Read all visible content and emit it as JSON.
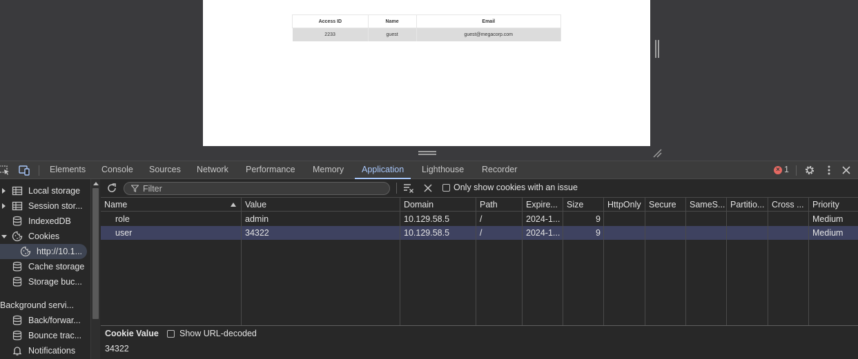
{
  "webpage": {
    "table": {
      "headers": [
        "Access ID",
        "Name",
        "Email"
      ],
      "rows": [
        [
          "2233",
          "guest",
          "guest@megacorp.com"
        ]
      ]
    }
  },
  "devtools": {
    "tabs": [
      {
        "label": "Elements",
        "active": false
      },
      {
        "label": "Console",
        "active": false
      },
      {
        "label": "Sources",
        "active": false
      },
      {
        "label": "Network",
        "active": false
      },
      {
        "label": "Performance",
        "active": false
      },
      {
        "label": "Memory",
        "active": false
      },
      {
        "label": "Application",
        "active": true
      },
      {
        "label": "Lighthouse",
        "active": false
      },
      {
        "label": "Recorder",
        "active": false
      }
    ],
    "error_count": "1",
    "sidebar": {
      "items": [
        {
          "label": "Local storage",
          "icon": "table-icon",
          "expandable": true
        },
        {
          "label": "Session stor...",
          "icon": "table-icon",
          "expandable": true
        },
        {
          "label": "IndexedDB",
          "icon": "database-icon"
        },
        {
          "label": "Cookies",
          "icon": "cookie-icon",
          "expanded": true
        },
        {
          "label": "http://10.1...",
          "icon": "cookie-icon",
          "selected": true
        },
        {
          "label": "Cache storage",
          "icon": "database-icon"
        },
        {
          "label": "Storage buc...",
          "icon": "database-icon"
        },
        {
          "label": "Background servi..."
        },
        {
          "label": "Back/forwar...",
          "icon": "database-icon"
        },
        {
          "label": "Bounce trac...",
          "icon": "database-icon"
        },
        {
          "label": "Notifications",
          "icon": "bell-icon"
        }
      ]
    },
    "toolbar": {
      "filter_placeholder": "Filter",
      "only_issue_label": "Only show cookies with an issue"
    },
    "cookies_table": {
      "columns": [
        "Name",
        "Value",
        "Domain",
        "Path",
        "Expire...",
        "Size",
        "HttpOnly",
        "Secure",
        "SameS...",
        "Partitio...",
        "Cross ...",
        "Priority"
      ],
      "sort_column": "Name",
      "rows": [
        {
          "name": "role",
          "value": "admin",
          "domain": "10.129.58.5",
          "path": "/",
          "expires": "2024-1...",
          "size": "9",
          "priority": "Medium"
        },
        {
          "name": "user",
          "value": "34322",
          "domain": "10.129.58.5",
          "path": "/",
          "expires": "2024-1...",
          "size": "9",
          "priority": "Medium",
          "selected": true
        }
      ]
    },
    "detail": {
      "title": "Cookie Value",
      "decode_label": "Show URL-decoded",
      "value": "34322"
    },
    "colors": {
      "accent": "#a8c7fa",
      "selected_row": "#3e4260",
      "error": "#e46962"
    }
  }
}
